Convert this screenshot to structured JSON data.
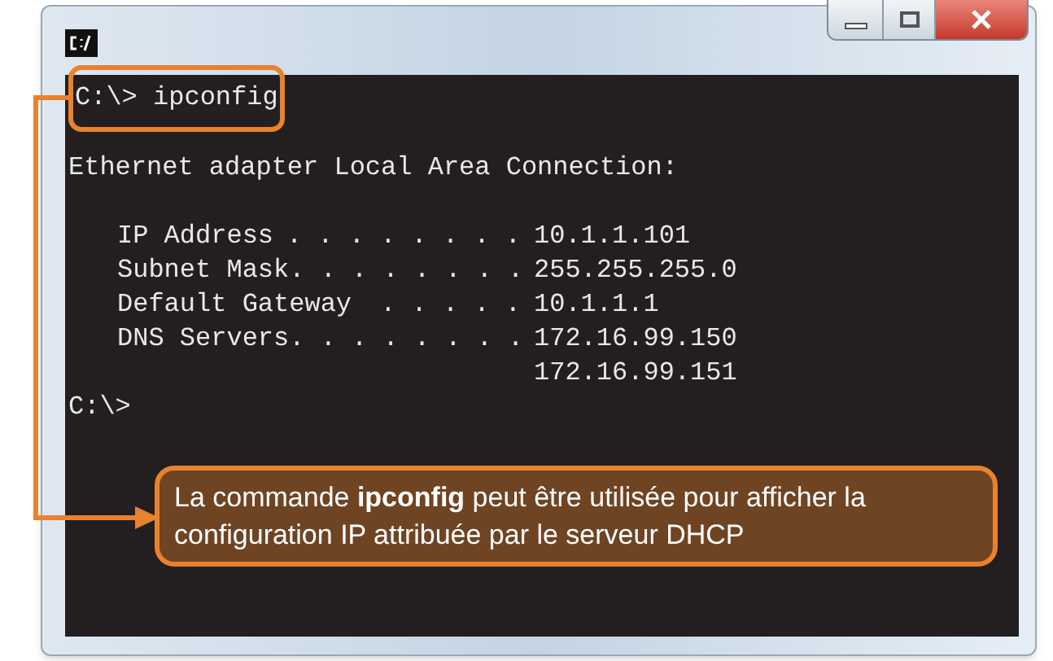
{
  "console": {
    "command_line": "C:\\> ipconfig",
    "adapter_heading": "Ethernet adapter Local Area Connection:",
    "entries": [
      {
        "label": "IP Address",
        "leader": ". . . . . . . .",
        "value": "10.1.1.101"
      },
      {
        "label": "Subnet Mask",
        "leader": ". . . . . . . .",
        "value": "255.255.255.0"
      },
      {
        "label": "Default Gateway",
        "leader": ". . . . .",
        "value": "10.1.1.1"
      },
      {
        "label": "DNS Servers",
        "leader": ". . . . . . . .",
        "value": "172.16.99.150"
      },
      {
        "value": "172.16.99.151"
      }
    ],
    "prompt": "C:\\>"
  },
  "callout": {
    "text": "La commande **ipconfig** peut être utilisée pour afficher la configuration IP attribuée par le serveur DHCP"
  }
}
